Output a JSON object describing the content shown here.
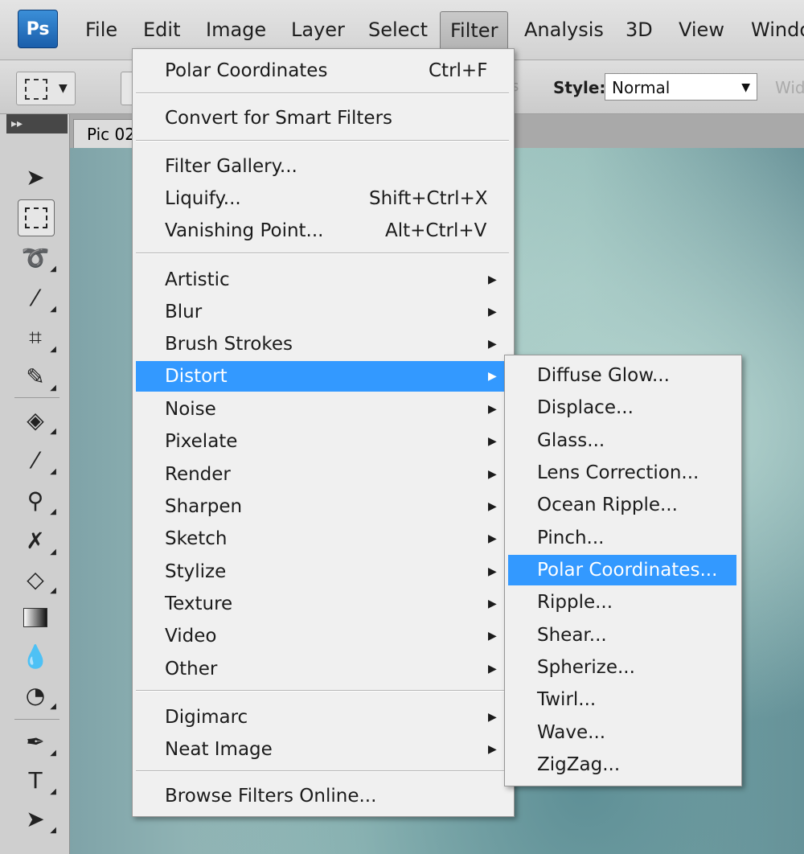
{
  "app": {
    "logo": "Ps"
  },
  "menubar": [
    "File",
    "Edit",
    "Image",
    "Layer",
    "Select",
    "Filter",
    "Analysis",
    "3D",
    "View",
    "Windo"
  ],
  "options": {
    "style_label": "Style:",
    "style_value": "Normal",
    "width_label": "Wid",
    "faded_glyph": "s"
  },
  "document": {
    "tab_title": "Pic 02"
  },
  "filter_menu": {
    "items": [
      {
        "label": "Polar Coordinates",
        "shortcut": "Ctrl+F"
      },
      {
        "label": "Convert for Smart Filters"
      },
      {
        "label": "Filter Gallery..."
      },
      {
        "label": "Liquify...",
        "shortcut": "Shift+Ctrl+X"
      },
      {
        "label": "Vanishing Point...",
        "shortcut": "Alt+Ctrl+V"
      },
      {
        "label": "Artistic",
        "submenu": true
      },
      {
        "label": "Blur",
        "submenu": true
      },
      {
        "label": "Brush Strokes",
        "submenu": true
      },
      {
        "label": "Distort",
        "submenu": true,
        "highlighted": true
      },
      {
        "label": "Noise",
        "submenu": true
      },
      {
        "label": "Pixelate",
        "submenu": true
      },
      {
        "label": "Render",
        "submenu": true
      },
      {
        "label": "Sharpen",
        "submenu": true
      },
      {
        "label": "Sketch",
        "submenu": true
      },
      {
        "label": "Stylize",
        "submenu": true
      },
      {
        "label": "Texture",
        "submenu": true
      },
      {
        "label": "Video",
        "submenu": true
      },
      {
        "label": "Other",
        "submenu": true
      },
      {
        "label": "Digimarc",
        "submenu": true
      },
      {
        "label": "Neat Image",
        "submenu": true
      },
      {
        "label": "Browse Filters Online..."
      }
    ]
  },
  "distort_submenu": {
    "items": [
      "Diffuse Glow...",
      "Displace...",
      "Glass...",
      "Lens Correction...",
      "Ocean Ripple...",
      "Pinch...",
      "Polar Coordinates...",
      "Ripple...",
      "Shear...",
      "Spherize...",
      "Twirl...",
      "Wave...",
      "ZigZag..."
    ],
    "highlighted_index": 6
  },
  "colors": {
    "highlight": "#3399ff",
    "menu_bg": "#f0f0f0"
  }
}
